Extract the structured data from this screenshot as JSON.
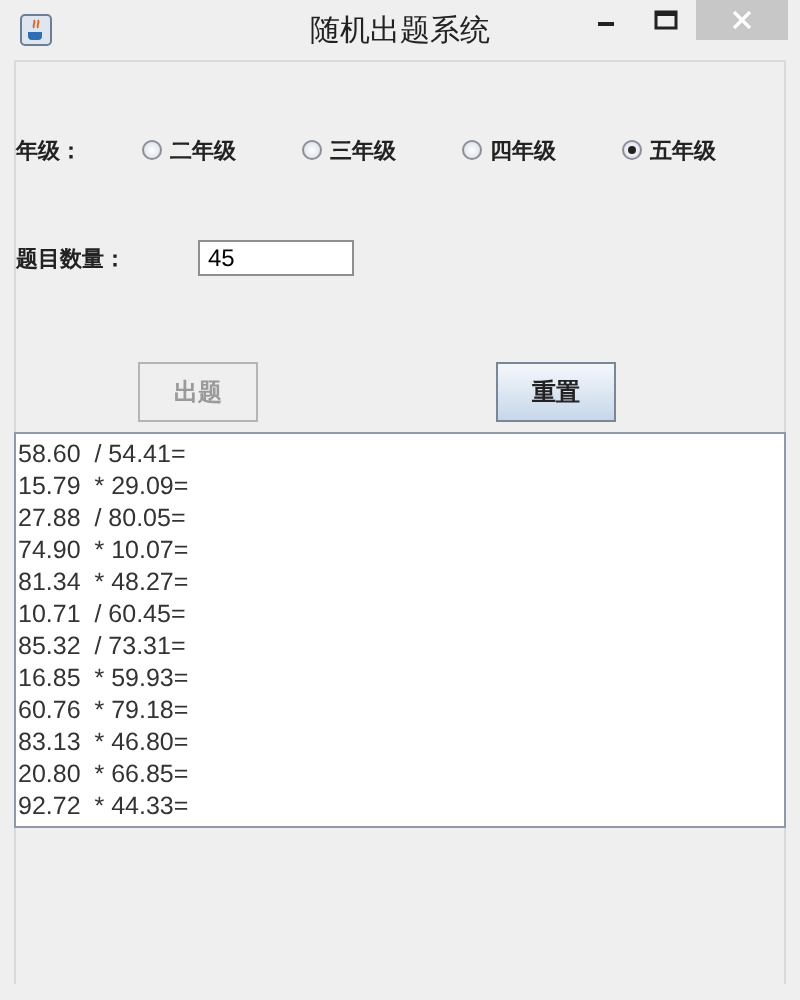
{
  "window": {
    "title": "随机出题系统"
  },
  "grade": {
    "label": "年级：",
    "options": [
      {
        "label": "二年级",
        "selected": false
      },
      {
        "label": "三年级",
        "selected": false
      },
      {
        "label": "四年级",
        "selected": false
      },
      {
        "label": "五年级",
        "selected": true
      }
    ]
  },
  "count": {
    "label": "题目数量：",
    "value": "45"
  },
  "buttons": [
    {
      "label": "出题",
      "disabled": true
    },
    {
      "label": "重置",
      "disabled": false
    }
  ],
  "output_lines": [
    "58.60  / 54.41=",
    "15.79  * 29.09=",
    "27.88  / 80.05=",
    "74.90  * 10.07=",
    "81.34  * 48.27=",
    "10.71  / 60.45=",
    "85.32  / 73.31=",
    "16.85  * 59.93=",
    "60.76  * 79.18=",
    "83.13  * 46.80=",
    "20.80  * 66.85=",
    "92.72  * 44.33="
  ]
}
